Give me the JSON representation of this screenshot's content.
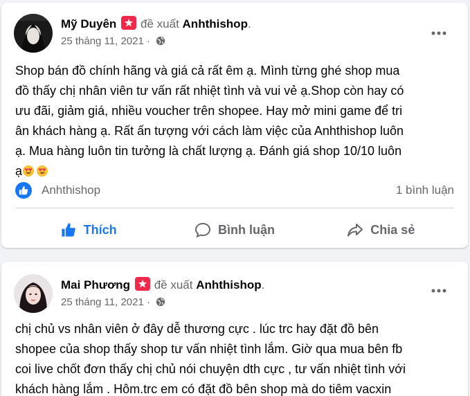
{
  "posts": [
    {
      "author": "Mỹ Duyên",
      "recommend_text": "đề xuất",
      "page_name": "Anhthishop",
      "period": ".",
      "date": "25 tháng 11, 2021",
      "separator": "·",
      "body_lines": [
        "Shop bán đồ chính hãng và giá cả rất êm ạ. Mình từng ghé shop mua",
        "đồ thấy chị nhân viên tư vấn rất nhiệt tình và vui vẻ ạ.Shop còn hay có",
        "ưu đãi, giảm giá, nhiều voucher trên shopee. Hay mở mini game để tri",
        "ân khách hàng ạ. Rất ấn tượng với cách làm việc của Anhthishop luôn",
        "ạ. Mua hàng luôn tin tưởng là chất lượng ạ. Đánh giá shop 10/10 luôn",
        "ạ"
      ],
      "reaction_page": "Anhthishop",
      "comments_count": "1 bình luận",
      "actions": {
        "like": "Thích",
        "comment": "Bình luận",
        "share": "Chia sẻ"
      }
    },
    {
      "author": "Mai Phương",
      "recommend_text": "đề xuất",
      "page_name": "Anhthishop",
      "period": ".",
      "date": "25 tháng 11, 2021",
      "separator": "·",
      "body_lines": [
        "chị chủ vs nhân viên ở đây dễ thương cực . lúc trc hay đặt đồ bên",
        "shopee của shop thấy shop tư vấn nhiệt tình lắm. Giờ qua mua bên fb",
        "coi live chốt đơn thấy chị chủ nói chuyện dth cực , tư vấn nhiệt tình với",
        "khách hàng lắm . Hôm.trc em có đặt đồ bên shop mà do tiêm vacxin"
      ]
    }
  ],
  "colors": {
    "accent": "#1877f2",
    "badge": "#f02849",
    "muted": "#65676b",
    "background": "#f0f2f5"
  },
  "icons": [
    "globe-icon",
    "more-icon",
    "like-icon",
    "comment-icon",
    "share-icon",
    "recommend-badge-icon",
    "heart-eyes-emoji"
  ]
}
